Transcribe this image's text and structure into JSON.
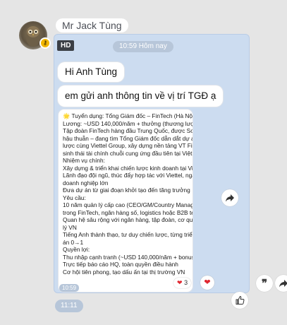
{
  "sender": {
    "name": "Mr Jack Tùng",
    "avatar": "owl-avatar",
    "badge_icon": "key-icon"
  },
  "group": {
    "hd_badge": "HD",
    "time_pill": "10:59 Hôm nay",
    "messages": [
      {
        "text": "Hi Anh Tùng"
      },
      {
        "text": "em gửi anh thông tin về vị trí TGĐ ạ"
      }
    ],
    "job_post": {
      "lines": [
        "🌟 Tuyển dụng: Tổng Giám đốc – FinTech (Hà Nội) 🌟",
        "Lương: ~USD 140,000/năm + thưởng (thương lượng)",
        "Tập đoàn FinTech hàng đầu Trung Quốc, được SoftBank",
        "hậu thuẫn – đang tìm Tổng Giám đốc dẫn dắt dự án chiến",
        "lược cùng Viettel Group, xây dựng nền tảng VT Finance, hệ",
        "sinh thái tài chính chuỗi cung ứng đầu tiên tại Việt Nam.",
        "Nhiệm vụ chính:",
        "Xây dựng & triển khai chiến lược kinh doanh tại Việt Nam",
        "Lãnh đạo đội ngũ, thúc đẩy hợp tác với Viettel, ngân hàng,",
        "doanh nghiệp lớn",
        "Đưa dự án từ giai đoạn khởi tạo đến tăng trưởng",
        "Yêu cầu:",
        "10 năm quản lý cấp cao (CEO/GM/Country Manager)",
        "trong FinTech, ngân hàng số, logistics hoặc B2B tech",
        "Quan hệ sâu rộng với ngân hàng, tập đoàn, cơ quan quản",
        "lý VN",
        "Tiếng Anh thành thạo, tư duy chiến lược, từng triển khai dự",
        "án 0→1",
        "Quyền lợi:",
        "Thu nhập cạnh tranh (~USD 140,000/năm + bonus)",
        "Trực tiếp báo cáo HQ, toàn quyền điều hành",
        "Cơ hội tiên phong, tạo dấu ấn tại thị trường VN"
      ],
      "time": "10:59",
      "reaction_count": "3",
      "reaction_icon": "heart-icon"
    }
  },
  "actions": {
    "share_icon": "share-arrow-icon",
    "like_icon": "thumbs-up-icon",
    "quote_icon": "quote-icon"
  },
  "bottom_time": "11:11",
  "colors": {
    "background": "#e5e5e5",
    "group_bg": "#ccdcf0",
    "heart": "#e0262f"
  }
}
